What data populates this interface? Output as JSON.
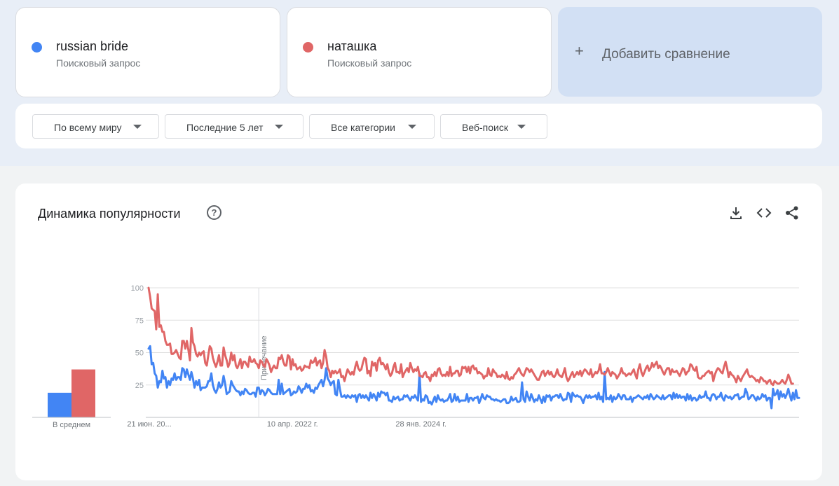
{
  "terms": [
    {
      "label": "russian bride",
      "sub": "Поисковый запрос",
      "color": "#4285f4"
    },
    {
      "label": "наташка",
      "sub": "Поисковый запрос",
      "color": "#e06666"
    }
  ],
  "add_compare": {
    "icon": "plus-icon",
    "label": "Добавить сравнение"
  },
  "filters": [
    {
      "label": "По всему миру"
    },
    {
      "label": "Последние 5 лет"
    },
    {
      "label": "Все категории"
    },
    {
      "label": "Веб-поиск"
    }
  ],
  "panel": {
    "title": "Динамика популярности",
    "help_icon": "help-icon",
    "tools": [
      "download-icon",
      "embed-icon",
      "share-icon"
    ]
  },
  "avg_label": "В среднем",
  "note_label": "Примечание",
  "chart_data": {
    "type": "line",
    "y_ticks": [
      25,
      50,
      75,
      100
    ],
    "ylim": [
      0,
      100
    ],
    "x_tick_labels": [
      "21 июн. 20...",
      "10 апр. 2022 г.",
      "28 янв. 2024 г."
    ],
    "averages": [
      {
        "name": "russian bride",
        "value": 19
      },
      {
        "name": "наташка",
        "value": 37
      }
    ],
    "series": [
      {
        "name": "russian bride",
        "color": "#4285f4",
        "values": [
          53,
          55,
          41,
          42,
          34,
          32,
          23,
          28,
          27,
          36,
          30,
          31,
          23,
          28,
          25,
          30,
          29,
          34,
          29,
          31,
          31,
          29,
          38,
          37,
          31,
          37,
          33,
          29,
          35,
          30,
          23,
          28,
          25,
          29,
          21,
          23,
          23,
          23,
          24,
          28,
          28,
          34,
          25,
          21,
          19,
          22,
          27,
          23,
          25,
          32,
          26,
          18,
          19,
          20,
          28,
          25,
          23,
          21,
          20,
          20,
          17,
          20,
          18,
          22,
          21,
          19,
          18,
          18,
          19,
          19,
          16,
          23,
          23,
          18,
          21,
          20,
          17,
          19,
          22,
          21,
          19,
          18,
          18,
          18,
          18,
          29,
          18,
          26,
          18,
          19,
          20,
          21,
          22,
          17,
          18,
          20,
          19,
          20,
          24,
          22,
          19,
          22,
          22,
          26,
          23,
          25,
          20,
          21,
          19,
          23,
          22,
          25,
          27,
          29,
          24,
          29,
          38,
          30,
          28,
          25,
          27,
          28,
          18,
          17,
          29,
          22,
          16,
          16,
          17,
          15,
          17,
          16,
          15,
          17,
          16,
          17,
          12,
          17,
          18,
          15,
          17,
          15,
          17,
          15,
          13,
          19,
          15,
          18,
          16,
          13,
          19,
          16,
          20,
          19,
          19,
          17,
          19,
          13,
          13,
          12,
          16,
          14,
          15,
          16,
          13,
          14,
          14,
          17,
          16,
          17,
          15,
          13,
          16,
          15,
          17,
          15,
          13,
          34,
          12,
          14,
          13,
          17,
          16,
          11,
          12,
          10,
          13,
          16,
          12,
          17,
          14,
          13,
          14,
          12,
          13,
          13,
          15,
          18,
          12,
          13,
          18,
          13,
          16,
          12,
          13,
          13,
          13,
          13,
          18,
          12,
          15,
          15,
          13,
          15,
          15,
          16,
          11,
          14,
          18,
          15,
          14,
          17,
          16,
          16,
          14,
          14,
          13,
          14,
          13,
          13,
          12,
          13,
          14,
          14,
          11,
          11,
          12,
          16,
          13,
          14,
          15,
          12,
          12,
          13,
          27,
          14,
          12,
          20,
          16,
          13,
          18,
          15,
          12,
          14,
          13,
          17,
          14,
          11,
          16,
          12,
          17,
          16,
          17,
          13,
          16,
          16,
          17,
          17,
          15,
          18,
          15,
          13,
          14,
          14,
          19,
          18,
          12,
          19,
          17,
          16,
          17,
          16,
          16,
          14,
          11,
          15,
          17,
          15,
          17,
          15,
          16,
          16,
          17,
          14,
          19,
          14,
          16,
          12,
          35,
          14,
          15,
          14,
          17,
          12,
          16,
          14,
          15,
          18,
          16,
          14,
          17,
          17,
          14,
          14,
          14,
          16,
          12,
          15,
          15,
          16,
          17,
          16,
          15,
          14,
          16,
          15,
          17,
          14,
          18,
          16,
          14,
          15,
          17,
          16,
          15,
          14,
          17,
          14,
          15,
          16,
          17,
          17,
          14,
          19,
          15,
          18,
          15,
          17,
          15,
          16,
          16,
          13,
          18,
          14,
          17,
          13,
          15,
          15,
          13,
          14,
          17,
          15,
          16,
          16,
          20,
          15,
          15,
          13,
          17,
          18,
          17,
          14,
          16,
          16,
          19,
          15,
          13,
          17,
          16,
          15,
          16,
          14,
          15,
          17,
          17,
          18,
          14,
          15,
          16,
          16,
          22,
          19,
          14,
          15,
          17,
          17,
          15,
          13,
          16,
          14,
          15,
          18,
          16,
          17,
          13,
          15,
          15,
          7,
          22,
          17,
          18,
          21,
          14,
          20,
          16,
          18,
          15,
          18,
          22,
          17,
          13,
          19,
          14,
          21,
          15,
          15
        ]
      },
      {
        "name": "наташка",
        "color": "#e06666",
        "values": [
          100,
          93,
          84,
          83,
          82,
          68,
          95,
          70,
          71,
          66,
          66,
          59,
          56,
          56,
          57,
          49,
          49,
          50,
          52,
          49,
          46,
          45,
          59,
          59,
          53,
          59,
          52,
          44,
          69,
          58,
          55,
          49,
          47,
          50,
          48,
          50,
          51,
          42,
          40,
          48,
          55,
          53,
          46,
          42,
          39,
          43,
          48,
          40,
          40,
          54,
          48,
          44,
          39,
          42,
          50,
          44,
          48,
          40,
          38,
          41,
          45,
          38,
          43,
          43,
          41,
          39,
          47,
          43,
          43,
          45,
          42,
          41,
          38,
          44,
          43,
          40,
          39,
          45,
          43,
          40,
          35,
          38,
          40,
          38,
          38,
          46,
          45,
          48,
          43,
          40,
          40,
          48,
          47,
          37,
          45,
          40,
          41,
          37,
          38,
          39,
          36,
          37,
          40,
          39,
          39,
          38,
          44,
          42,
          43,
          46,
          40,
          43,
          44,
          38,
          42,
          52,
          47,
          38,
          36,
          31,
          36,
          34,
          36,
          34,
          35,
          37,
          31,
          32,
          28,
          33,
          37,
          35,
          33,
          35,
          33,
          39,
          43,
          38,
          36,
          37,
          42,
          46,
          45,
          34,
          36,
          32,
          43,
          40,
          42,
          36,
          44,
          46,
          41,
          42,
          40,
          37,
          41,
          35,
          32,
          34,
          39,
          42,
          35,
          35,
          34,
          41,
          31,
          34,
          36,
          38,
          35,
          42,
          38,
          35,
          37,
          36,
          39,
          32,
          32,
          31,
          34,
          35,
          31,
          31,
          28,
          33,
          32,
          35,
          32,
          37,
          38,
          34,
          32,
          33,
          32,
          35,
          32,
          39,
          32,
          34,
          34,
          36,
          36,
          32,
          33,
          39,
          38,
          39,
          35,
          39,
          34,
          39,
          40,
          37,
          38,
          34,
          35,
          34,
          33,
          30,
          32,
          32,
          38,
          33,
          32,
          37,
          35,
          34,
          31,
          32,
          31,
          33,
          32,
          30,
          35,
          30,
          29,
          31,
          30,
          33,
          34,
          36,
          38,
          35,
          33,
          32,
          35,
          38,
          37,
          35,
          37,
          35,
          33,
          31,
          29,
          29,
          32,
          35,
          36,
          32,
          34,
          36,
          33,
          35,
          32,
          31,
          33,
          37,
          33,
          32,
          31,
          34,
          38,
          31,
          28,
          30,
          33,
          35,
          31,
          33,
          35,
          33,
          36,
          32,
          35,
          37,
          36,
          34,
          33,
          37,
          31,
          33,
          35,
          34,
          36,
          41,
          34,
          34,
          33,
          35,
          38,
          35,
          32,
          35,
          34,
          33,
          30,
          32,
          34,
          38,
          34,
          34,
          32,
          33,
          34,
          33,
          35,
          37,
          33,
          30,
          37,
          41,
          35,
          32,
          35,
          38,
          40,
          36,
          38,
          42,
          39,
          41,
          43,
          38,
          40,
          38,
          35,
          33,
          36,
          38,
          38,
          33,
          37,
          35,
          35,
          36,
          34,
          32,
          35,
          38,
          37,
          33,
          35,
          36,
          41,
          40,
          37,
          36,
          39,
          31,
          30,
          30,
          32,
          32,
          34,
          35,
          36,
          34,
          35,
          28,
          33,
          36,
          38,
          37,
          35,
          34,
          39,
          43,
          38,
          31,
          35,
          33,
          32,
          30,
          27,
          32,
          30,
          28,
          31,
          33,
          35,
          37,
          33,
          31,
          32,
          31,
          30,
          28,
          29,
          27,
          31,
          30,
          28,
          28,
          26,
          28,
          29,
          26,
          25,
          28,
          27,
          26,
          26,
          27,
          29,
          27,
          26,
          29,
          33,
          30,
          26,
          26
        ]
      }
    ]
  }
}
